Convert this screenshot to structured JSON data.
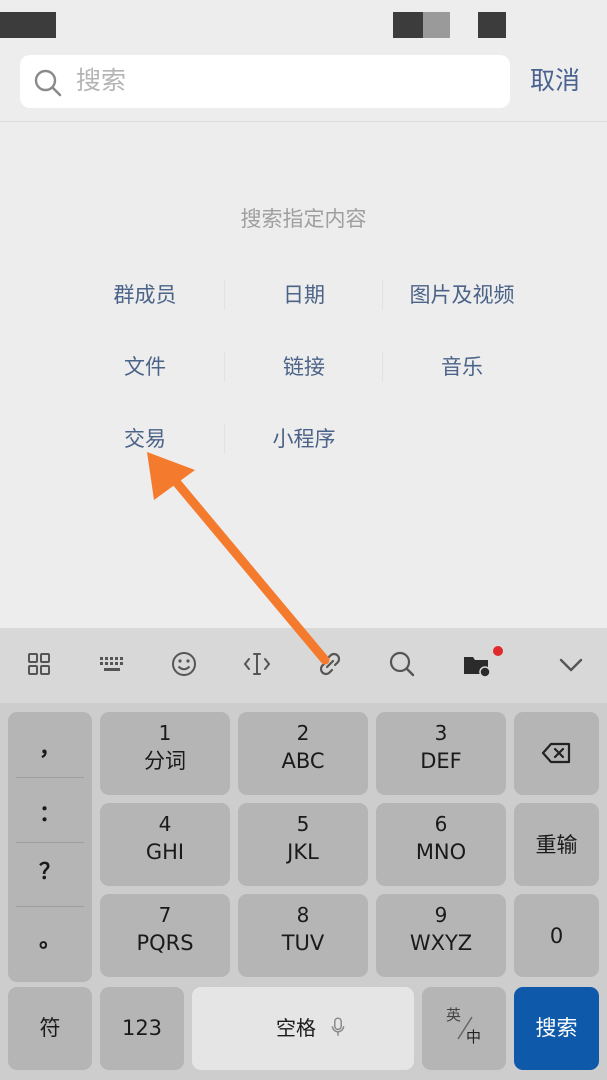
{
  "search": {
    "placeholder": "搜索",
    "cancel_label": "取消"
  },
  "hint": "搜索指定内容",
  "categories": [
    "群成员",
    "日期",
    "图片及视频",
    "文件",
    "链接",
    "音乐",
    "交易",
    "小程序"
  ],
  "toolbar": {
    "icons": [
      "grid-icon",
      "keyboard-icon",
      "emoji-icon",
      "cursor-icon",
      "link-icon",
      "search-icon",
      "folder-icon",
      "collapse-icon"
    ]
  },
  "keyboard": {
    "punctuation": [
      "，",
      "：",
      "？",
      "。"
    ],
    "keys": [
      {
        "num": "1",
        "letters": "分词"
      },
      {
        "num": "2",
        "letters": "ABC"
      },
      {
        "num": "3",
        "letters": "DEF"
      },
      {
        "num": "4",
        "letters": "GHI"
      },
      {
        "num": "5",
        "letters": "JKL"
      },
      {
        "num": "6",
        "letters": "MNO"
      },
      {
        "num": "7",
        "letters": "PQRS"
      },
      {
        "num": "8",
        "letters": "TUV"
      },
      {
        "num": "9",
        "letters": "WXYZ"
      }
    ],
    "reenter": "重输",
    "zero": "0",
    "symbols": "符",
    "numbers": "123",
    "space": "空格",
    "lang_top": "英",
    "lang_bottom": "中",
    "search": "搜索"
  },
  "colors": {
    "accent_blue": "#0e59a9",
    "link_text": "#4b6388",
    "arrow": "#f47a2d",
    "notification_dot": "#e0292b"
  }
}
